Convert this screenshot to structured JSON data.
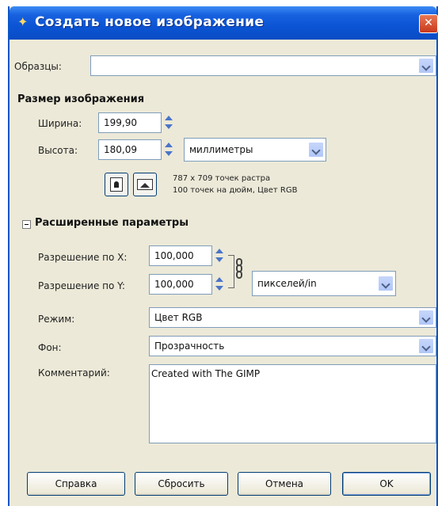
{
  "window": {
    "title": "Создать новое изображение",
    "close_glyph": "✕"
  },
  "templates": {
    "label": "Образцы:",
    "value": ""
  },
  "image_size": {
    "heading": "Размер изображения",
    "width_label": "Ширина:",
    "width_value": "199,90",
    "height_label": "Высота:",
    "height_value": "180,09",
    "unit": "миллиметры",
    "info_line1": "787 x 709 точек растра",
    "info_line2": "100 точек на дюйм, Цвет RGB"
  },
  "advanced": {
    "heading": "Расширенные параметры",
    "res_x_label": "Разрешение по X:",
    "res_x_value": "100,000",
    "res_y_label": "Разрешение по Y:",
    "res_y_value": "100,000",
    "res_unit": "пикселей/in",
    "mode_label": "Режим:",
    "mode_value": "Цвет RGB",
    "fill_label": "Фон:",
    "fill_value": "Прозрачность",
    "comment_label": "Комментарий:",
    "comment_value": "Created with The GIMP"
  },
  "buttons": {
    "help": "Справка",
    "reset": "Сбросить",
    "cancel": "Отмена",
    "ok": "OK"
  }
}
